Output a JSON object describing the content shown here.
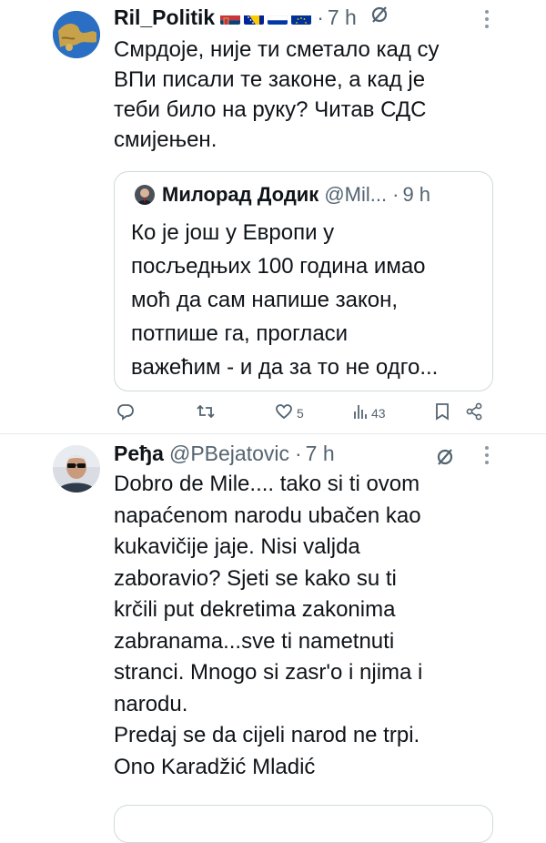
{
  "tweets": [
    {
      "display_name": "Ril_Politik",
      "time": "7 h",
      "text": "Смрдоје, није ти сметало кад су\nВПи писали те законе, а кад је\nтеби било на руку? Читав СДС\nсмијењен.",
      "quote": {
        "display_name": "Милорад Додик",
        "handle": "@Mil...",
        "time": "9 h",
        "text_lines": [
          "Ко је још у Европи у",
          "посљедњих 100 година имао",
          "моћ да сам напише закон,",
          "потпише га, прогласи",
          "важећим - и да за то не одго..."
        ]
      },
      "actions": {
        "reply_count": "",
        "repost_count": "",
        "like_count": "5",
        "views_count": "43"
      }
    },
    {
      "display_name": "Pеђа",
      "handle": "@PBejatovic",
      "time": "7 h",
      "text": "Dobro de Mile.... tako si ti ovom\nnapaćenom narodu ubačen kao\nkukavičije jaje. Nisi valjda\nzaboravio? Sjeti se kako su ti\nkrčili put dekretima zakonima\nzabranama...sve ti nametnuti\nstranci. Mnogo si zasr'o i njima i\nnarodu.\nPredaj se da cijeli narod ne trpi.\nOno Karadžić Mladić"
    }
  ],
  "separator": "·",
  "icons": {
    "more": "more-dots-icon",
    "grok": "grok-icon",
    "reply": "reply-icon",
    "repost": "repost-icon",
    "like": "like-icon",
    "views": "views-icon",
    "bookmark": "bookmark-icon",
    "share": "share-icon"
  },
  "colors": {
    "text": "#0f1419",
    "muted": "#536471",
    "border": "#cfd9de"
  }
}
